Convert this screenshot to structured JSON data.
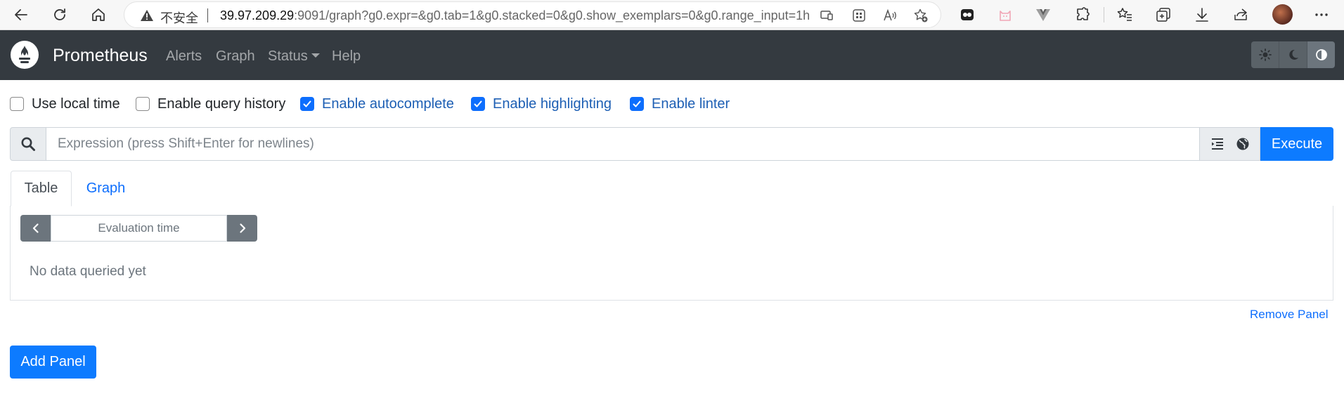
{
  "browser": {
    "insecure_label": "不安全",
    "url_host": "39.97.209.29",
    "url_rest": ":9091/graph?g0.expr=&g0.tab=1&g0.stacked=0&g0.show_exemplars=0&g0.range_input=1h"
  },
  "navbar": {
    "brand": "Prometheus",
    "links": [
      "Alerts",
      "Graph",
      "Status",
      "Help"
    ]
  },
  "options": [
    {
      "label": "Use local time",
      "checked": false
    },
    {
      "label": "Enable query history",
      "checked": false
    },
    {
      "label": "Enable autocomplete",
      "checked": true
    },
    {
      "label": "Enable highlighting",
      "checked": true
    },
    {
      "label": "Enable linter",
      "checked": true
    }
  ],
  "expression": {
    "placeholder": "Expression (press Shift+Enter for newlines)",
    "value": "",
    "execute_label": "Execute"
  },
  "panel": {
    "tabs": [
      "Table",
      "Graph"
    ],
    "active_tab": "Table",
    "eval_placeholder": "Evaluation time",
    "empty_message": "No data queried yet",
    "remove_label": "Remove Panel"
  },
  "add_panel_label": "Add Panel",
  "colors": {
    "navbar_bg": "#343a40",
    "primary": "#0d7bff",
    "link": "#0d6efd"
  }
}
